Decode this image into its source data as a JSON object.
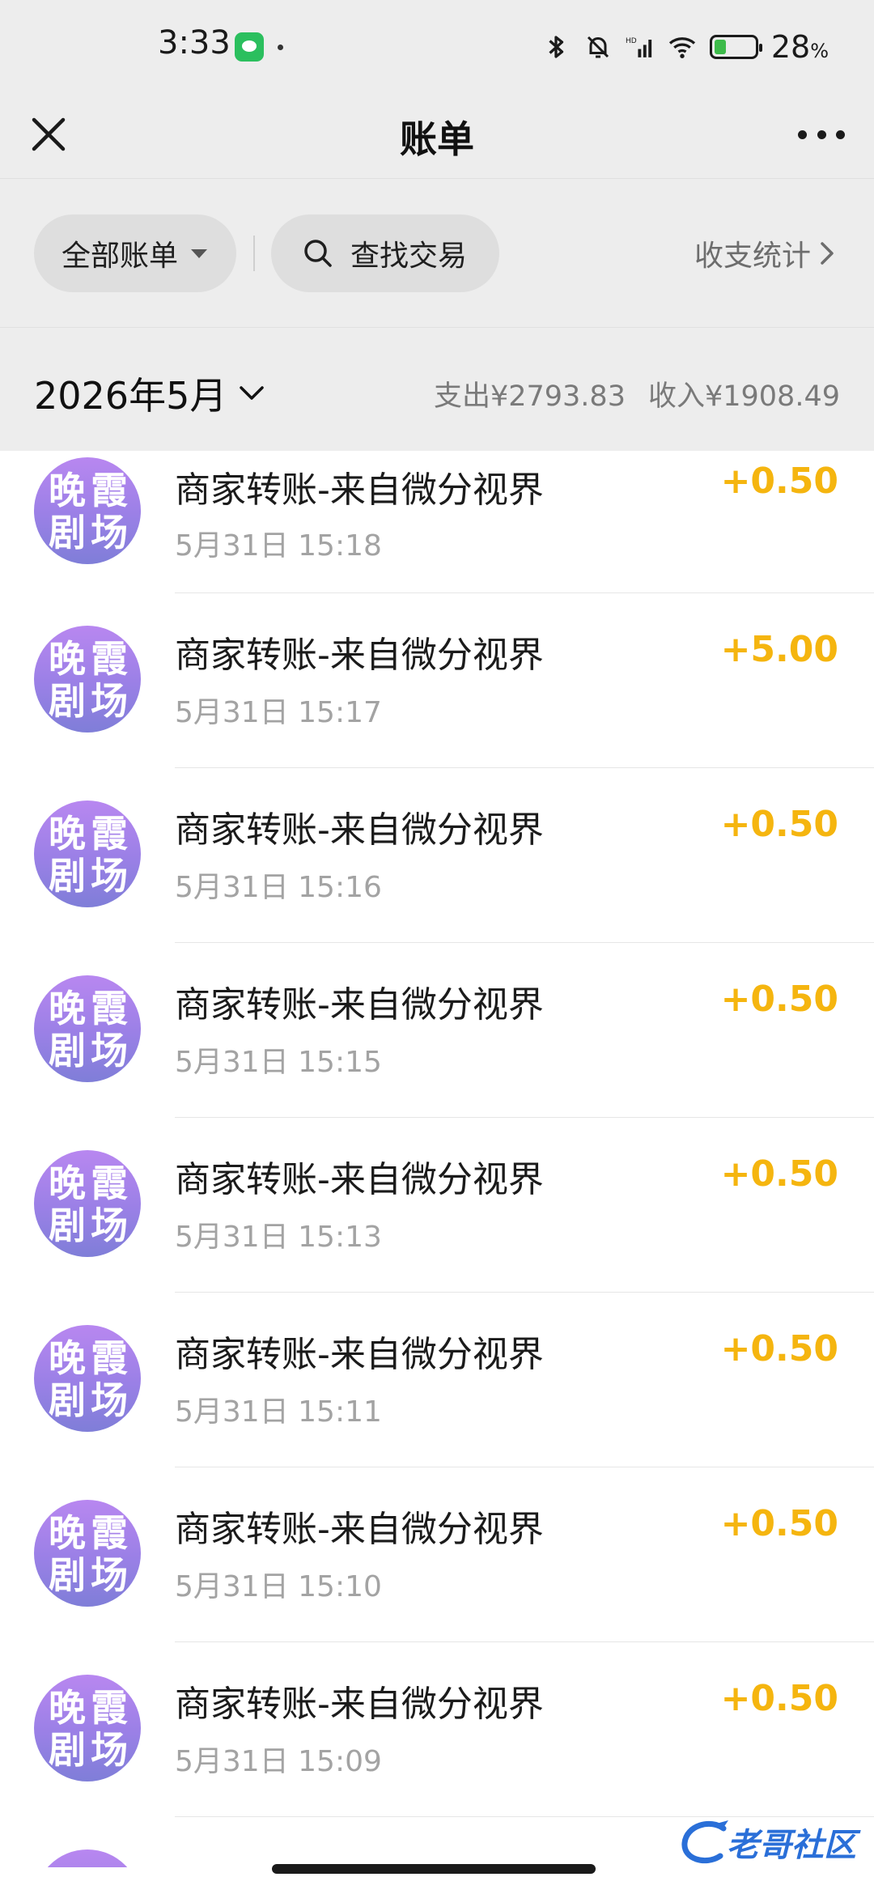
{
  "status_bar": {
    "time": "3:33",
    "battery_percent": "28",
    "battery_unit": "%",
    "app_icon": "wechat-icon",
    "icons": [
      "bluetooth-icon",
      "mute-bell-icon",
      "signal-hd-icon",
      "wifi-icon",
      "battery-icon"
    ]
  },
  "nav": {
    "title": "账单",
    "close_icon": "close-icon",
    "more_icon": "more-icon"
  },
  "filters": {
    "all_bills": "全部账单",
    "search": "查找交易",
    "stats": "收支统计"
  },
  "month": {
    "label": "2026年5月",
    "expense": "支出¥2793.83",
    "income": "收入¥1908.49"
  },
  "avatar_text": [
    "晚",
    "霞",
    "剧",
    "场"
  ],
  "transactions": [
    {
      "title": "商家转账-来自微分视界",
      "time": "5月31日 15:18",
      "amount": "+0.50"
    },
    {
      "title": "商家转账-来自微分视界",
      "time": "5月31日 15:17",
      "amount": "+5.00"
    },
    {
      "title": "商家转账-来自微分视界",
      "time": "5月31日 15:16",
      "amount": "+0.50"
    },
    {
      "title": "商家转账-来自微分视界",
      "time": "5月31日 15:15",
      "amount": "+0.50"
    },
    {
      "title": "商家转账-来自微分视界",
      "time": "5月31日 15:13",
      "amount": "+0.50"
    },
    {
      "title": "商家转账-来自微分视界",
      "time": "5月31日 15:11",
      "amount": "+0.50"
    },
    {
      "title": "商家转账-来自微分视界",
      "time": "5月31日 15:10",
      "amount": "+0.50"
    },
    {
      "title": "商家转账-来自微分视界",
      "time": "5月31日 15:09",
      "amount": "+0.50"
    }
  ],
  "watermark": {
    "text": "老哥社区"
  },
  "colors": {
    "amount": "#f5b50f",
    "header_bg": "#ededed",
    "avatar_gradient": [
      "#b887f0",
      "#7f7ed8"
    ]
  }
}
